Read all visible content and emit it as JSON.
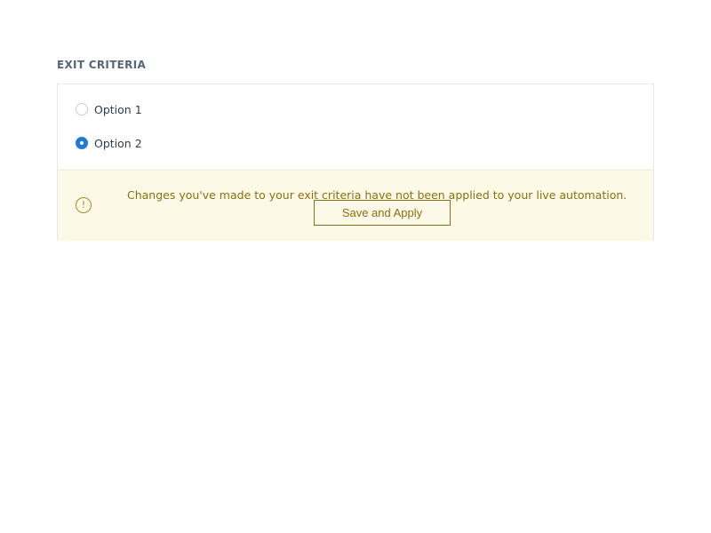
{
  "section": {
    "title": "EXIT CRITERIA"
  },
  "options": [
    {
      "label": "Option 1",
      "checked": false
    },
    {
      "label": "Option 2",
      "checked": true
    }
  ],
  "notice": {
    "icon": "exclamation-circle-icon",
    "message": "Changes you've made to your exit criteria have not been applied to your live automation.",
    "button_label": "Save and Apply"
  },
  "colors": {
    "accent": "#1f7ad9",
    "notice_background": "#fdf9e7",
    "notice_text": "#8b6f12",
    "title": "#56667a"
  }
}
